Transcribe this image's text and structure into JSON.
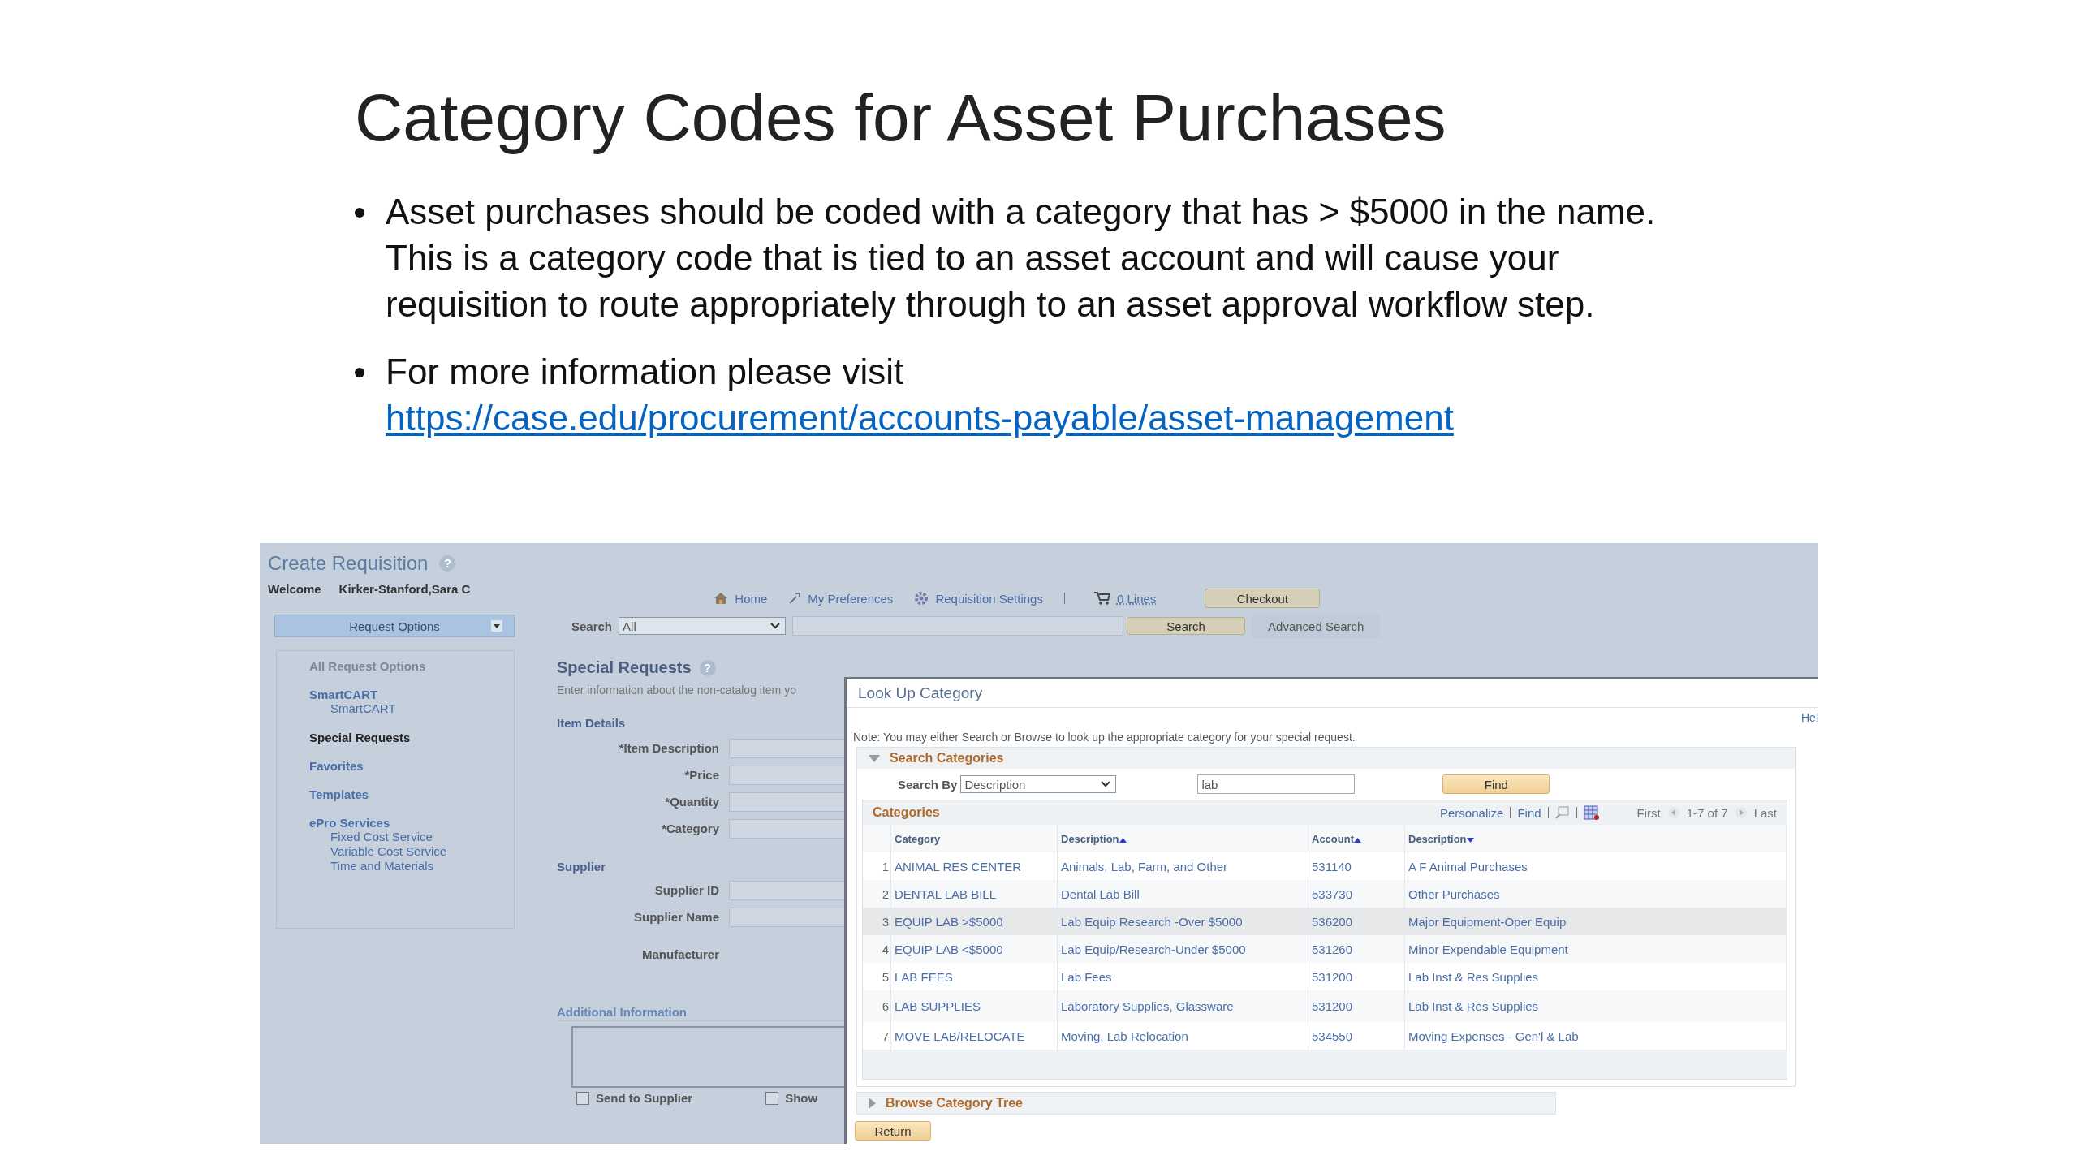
{
  "slide": {
    "title": "Category Codes for Asset Purchases",
    "bullets": [
      {
        "text": "Asset purchases should be coded with a category that has > $5000 in the name.  This is a category code that is tied to an asset account and will cause your requisition to route appropriately through to an asset approval workflow step."
      },
      {
        "text": "For more information please visit",
        "link": "https://case.edu/procurement/accounts-payable/asset-management"
      }
    ]
  },
  "app": {
    "page_title": "Create Requisition",
    "help_mark": "?",
    "welcome_label": "Welcome",
    "user_name": "Kirker-Stanford,Sara C",
    "nav_links": [
      {
        "label": "Home",
        "kind": "home"
      },
      {
        "label": "My Preferences",
        "kind": "preferences"
      },
      {
        "label": "Requisition Settings",
        "kind": "settings"
      }
    ],
    "cart": {
      "label": "0 Lines"
    },
    "checkout_button": "Checkout",
    "request_options": "Request Options",
    "search": {
      "label": "Search",
      "scope": "All",
      "button": "Search",
      "advanced": "Advanced Search"
    },
    "sidebar": {
      "heading": "All Request Options",
      "items": [
        {
          "label": "SmartCART",
          "selected": false,
          "children": [
            {
              "label": "SmartCART",
              "selected": false
            }
          ]
        },
        {
          "label": "Special Requests",
          "selected": true
        },
        {
          "label": "Favorites",
          "selected": false
        },
        {
          "label": "Templates",
          "selected": false
        },
        {
          "label": "ePro Services",
          "selected": false,
          "children": [
            {
              "label": "Fixed Cost Service",
              "selected": false
            },
            {
              "label": "Variable Cost Service",
              "selected": false
            },
            {
              "label": "Time and Materials",
              "selected": false
            }
          ]
        }
      ]
    },
    "special_requests": {
      "title": "Special Requests",
      "intro": "Enter information about the non-catalog item yo",
      "sections": [
        {
          "heading": "Item Details",
          "fields": [
            {
              "label": "*Item Description",
              "kind": "input"
            },
            {
              "label": "*Price",
              "kind": "input"
            },
            {
              "label": "*Quantity",
              "kind": "input"
            },
            {
              "label": "*Category",
              "kind": "input"
            }
          ]
        },
        {
          "heading": "Supplier",
          "fields": [
            {
              "label": "Supplier ID",
              "kind": "input"
            },
            {
              "label": "Supplier Name",
              "kind": "input"
            },
            {
              "label": "Manufacturer",
              "kind": "label"
            }
          ]
        }
      ],
      "additional_heading": "Additional Information",
      "checkboxes": [
        {
          "label": "Send to Supplier",
          "checked": false
        },
        {
          "label": "Show",
          "checked": false
        }
      ]
    }
  },
  "lookup": {
    "title": "Look Up Category",
    "help_link": "Hel",
    "note": "Note: You may either Search or Browse to look up the appropriate category for your special request.",
    "search_section": {
      "title": "Search Categories",
      "expanded": true,
      "search_by_label": "Search By",
      "search_by": "Description",
      "query": "lab",
      "find_button": "Find"
    },
    "grid": {
      "title": "Categories",
      "toolbar": {
        "personalize": "Personalize",
        "find": "Find",
        "first": "First",
        "range": "1-7 of 7",
        "last": "Last"
      },
      "columns": [
        {
          "label": "Category",
          "sorted": false
        },
        {
          "label": "Description",
          "sorted": true,
          "descending": false
        },
        {
          "label": "Account",
          "sorted": true,
          "descending": false
        },
        {
          "label": "Description",
          "sorted": true,
          "descending": true
        }
      ],
      "rows": [
        {
          "number": "1",
          "cells": [
            "ANIMAL RES CENTER",
            "Animals, Lab, Farm, and Other",
            "531140",
            "A F Animal Purchases"
          ],
          "selected": false
        },
        {
          "number": "2",
          "cells": [
            "DENTAL LAB BILL",
            "Dental Lab Bill",
            "533730",
            "Other Purchases"
          ],
          "selected": false
        },
        {
          "number": "3",
          "cells": [
            "EQUIP LAB >$5000",
            "Lab Equip Research -Over $5000",
            "536200",
            "Major Equipment-Oper Equip"
          ],
          "selected": true
        },
        {
          "number": "4",
          "cells": [
            "EQUIP LAB <$5000",
            "Lab Equip/Research-Under $5000",
            "531260",
            "Minor Expendable Equipment"
          ],
          "selected": false
        },
        {
          "number": "5",
          "cells": [
            "LAB FEES",
            "Lab Fees",
            "531200",
            "Lab Inst & Res Supplies"
          ],
          "selected": false
        },
        {
          "number": "6",
          "cells": [
            "LAB SUPPLIES",
            "Laboratory Supplies, Glassware",
            "531200",
            "Lab Inst & Res Supplies"
          ],
          "selected": false
        },
        {
          "number": "7",
          "cells": [
            "MOVE LAB/RELOCATE",
            "Moving, Lab Relocation",
            "534550",
            "Moving Expenses - Gen'l & Lab"
          ],
          "selected": false
        }
      ]
    },
    "browse_section": {
      "title": "Browse Category Tree",
      "expanded": false
    },
    "return_button": "Return"
  }
}
